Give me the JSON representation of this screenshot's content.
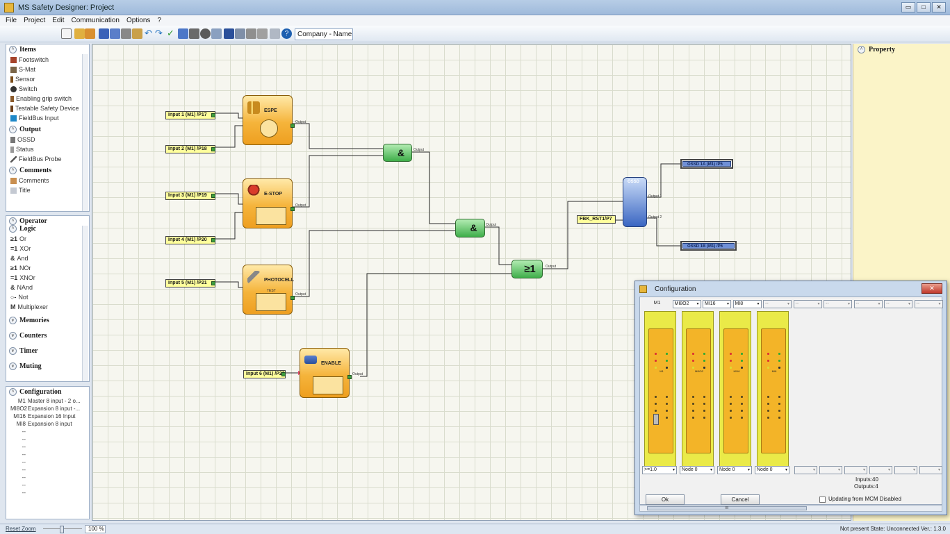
{
  "window": {
    "title": "MS     Safety Designer: Project"
  },
  "menu": [
    "File",
    "Project",
    "Edit",
    "Communication",
    "Options",
    "?"
  ],
  "toolbar": {
    "company_field": "Company - Name"
  },
  "items_panel": {
    "title": "Items",
    "items": [
      "Footswitch",
      "S-Mat",
      "Sensor",
      "Switch",
      "Enabling grip switch",
      "Testable Safety Device",
      "FieldBus Input"
    ],
    "output_title": "Output",
    "output_items": [
      "OSSD",
      "Status",
      "FieldBus Probe"
    ],
    "comments_title": "Comments",
    "comments_items": [
      "Comments",
      "Title"
    ]
  },
  "operator_panel": {
    "title": "Operator",
    "logic_title": "Logic",
    "logic_items": [
      {
        "sym": "≥1",
        "label": "Or"
      },
      {
        "sym": "=1",
        "label": "XOr"
      },
      {
        "sym": "&",
        "label": "And"
      },
      {
        "sym": "≥1",
        "label": "NOr"
      },
      {
        "sym": "=1",
        "label": "XNOr"
      },
      {
        "sym": "&",
        "label": "NAnd"
      },
      {
        "sym": "○-",
        "label": "Not"
      },
      {
        "sym": "M",
        "label": "Multiplexer"
      }
    ],
    "memories": "Memories",
    "counters": "Counters",
    "timer": "Timer",
    "muting": "Muting"
  },
  "config_panel": {
    "title": "Configuration",
    "rows": [
      {
        "code": "M1",
        "desc": "Master 8 input - 2 o..."
      },
      {
        "code": "MI8O2",
        "desc": "Expansion 8 input -..."
      },
      {
        "code": "MI16",
        "desc": "Expansion 16 Input"
      },
      {
        "code": "MI8",
        "desc": "Expansion 8 input"
      },
      {
        "code": "--",
        "desc": ""
      },
      {
        "code": "--",
        "desc": ""
      },
      {
        "code": "--",
        "desc": ""
      },
      {
        "code": "--",
        "desc": ""
      },
      {
        "code": "--",
        "desc": ""
      },
      {
        "code": "--",
        "desc": ""
      },
      {
        "code": "--",
        "desc": ""
      },
      {
        "code": "--",
        "desc": ""
      },
      {
        "code": "--",
        "desc": ""
      }
    ]
  },
  "diagram": {
    "inputs": [
      "Input 1 (M1) /P17",
      "Input 2 (M1) /P18",
      "Input 3 (M1) /P19",
      "Input 4 (M1) /P20",
      "Input 5 (M1) /P21",
      "Input 6 (M1) /P22",
      "FBK_RST1/P7"
    ],
    "blocks": {
      "espe": "ESPE",
      "estop": "E-STOP",
      "photocell": "PHOTOCELL",
      "test": "TEST",
      "enable": "ENABLE",
      "ossd": "OSSD"
    },
    "output_text": "Output",
    "ossd_out1": "Output 1",
    "ossd_out2": "Output 2",
    "and_sym": "&",
    "or_sym": "≥1",
    "ossd_labels": [
      "OSSD 1A (M1) /P5",
      "OSSD 1B (M1) /P6"
    ]
  },
  "property_panel": {
    "title": "Property"
  },
  "config_dialog": {
    "title": "Configuration",
    "slots": [
      "M1",
      "MI8O2",
      "MI16",
      "MI8",
      "--",
      "--",
      "--",
      "--",
      "--",
      "--"
    ],
    "module_names": [
      "M1",
      "MI8O2",
      "MI16",
      "MI8"
    ],
    "fw": ">=1.0",
    "nodes": [
      "Node 0",
      "Node 0",
      "Node 0"
    ],
    "inputs_count": "Inputs:40",
    "outputs_count": "Outputs:4",
    "ok": "Ok",
    "cancel": "Cancel",
    "updating": "Updating from MCM Disabled",
    "scroll_mark": "III"
  },
  "statusbar": {
    "reset_zoom": "Reset Zoom",
    "zoom": "100 %",
    "status": "Not present   State: Unconnected   Ver.: 1.3.0"
  },
  "colors": {
    "block_orange": "#f5b43b",
    "gate_green": "#3fae4a",
    "ossd_blue": "#3a66c2",
    "input_yellow": "#ffff9c",
    "canvas_bg": "#f6f6ef",
    "property_bg": "#fbf4c8"
  }
}
